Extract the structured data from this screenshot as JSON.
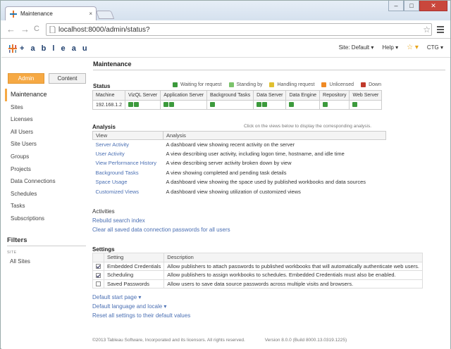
{
  "browser": {
    "tab_title": "Maintenance",
    "tab_close": "×",
    "win_min": "–",
    "win_max": "□",
    "win_close": "✕",
    "back": "←",
    "forward": "→",
    "reload": "C",
    "url": "localhost:8000/admin/status?",
    "bookmark_star": "☆"
  },
  "header": {
    "logo_text": "+ a b l e a u",
    "site": "Site: Default ▾",
    "help": "Help ▾",
    "favorites": "☆ ▾",
    "user": "CTG ▾"
  },
  "page_title": "Maintenance",
  "switch": {
    "admin": "Admin",
    "content": "Content"
  },
  "sidebar": {
    "items": [
      {
        "label": "Maintenance",
        "active": true
      },
      {
        "label": "Sites"
      },
      {
        "label": "Licenses"
      },
      {
        "label": "All Users"
      },
      {
        "label": "Site Users"
      },
      {
        "label": "Groups"
      },
      {
        "label": "Projects"
      },
      {
        "label": "Data Connections"
      },
      {
        "label": "Schedules"
      },
      {
        "label": "Tasks"
      },
      {
        "label": "Subscriptions"
      }
    ],
    "filters_title": "Filters",
    "site_label": "SITE",
    "all_sites": "All Sites"
  },
  "status": {
    "title": "Status",
    "legend": [
      {
        "label": "Waiting for request",
        "color": "#3c9a3c"
      },
      {
        "label": "Standing by",
        "color": "#7bc36b"
      },
      {
        "label": "Handling request",
        "color": "#e0c030"
      },
      {
        "label": "Unlicensed",
        "color": "#f08a24"
      },
      {
        "label": "Down",
        "color": "#c0392b"
      }
    ],
    "columns": [
      "Machine",
      "VizQL Server",
      "Application Server",
      "Background Tasks",
      "Data Server",
      "Data Engine",
      "Repository",
      "Web Server"
    ],
    "machine": "192.168.1.2",
    "checks": [
      2,
      2,
      1,
      2,
      1,
      1,
      1
    ]
  },
  "analysis": {
    "title": "Analysis",
    "hint": "Click on the views below to display the corresponding analysis.",
    "col_view": "View",
    "col_analysis": "Analysis",
    "rows": [
      {
        "view": "Server Activity",
        "desc": "A dashboard view showing recent activity on the server"
      },
      {
        "view": "User Activity",
        "desc": "A view describing user activity, including logon time, hostname, and idle time"
      },
      {
        "view": "View Performance History",
        "desc": "A view describing server activity broken down by view"
      },
      {
        "view": "Background Tasks",
        "desc": "A view showing completed and pending task details"
      },
      {
        "view": "Space Usage",
        "desc": "A dashboard view showing the space used by published workbooks and data sources"
      },
      {
        "view": "Customized Views",
        "desc": "A dashboard view showing utilization of customized views"
      }
    ]
  },
  "activities": {
    "title": "Activities",
    "rebuild": "Rebuild search index",
    "clear": "Clear all saved data connection passwords for all users"
  },
  "settings": {
    "title": "Settings",
    "col_setting": "Setting",
    "col_desc": "Description",
    "rows": [
      {
        "name": "Embedded Credentials",
        "checked": true,
        "desc": "Allow publishers to attach passwords to published workbooks that will automatically authenticate web users."
      },
      {
        "name": "Scheduling",
        "checked": true,
        "desc": "Allow publishers to assign workbooks to schedules. Embedded Credentials must also be enabled."
      },
      {
        "name": "Saved Passwords",
        "checked": false,
        "desc": "Allow users to save data source passwords across multiple visits and browsers."
      }
    ],
    "default_start": "Default start page ▾",
    "default_lang": "Default language and locale ▾",
    "reset": "Reset all settings to their default values"
  },
  "footer": {
    "copyright": "©2013 Tableau Software, Incorporated and its licensors. All rights reserved.",
    "version": "Version 8.0.0 (Build 8000.13.0319.1225)"
  }
}
